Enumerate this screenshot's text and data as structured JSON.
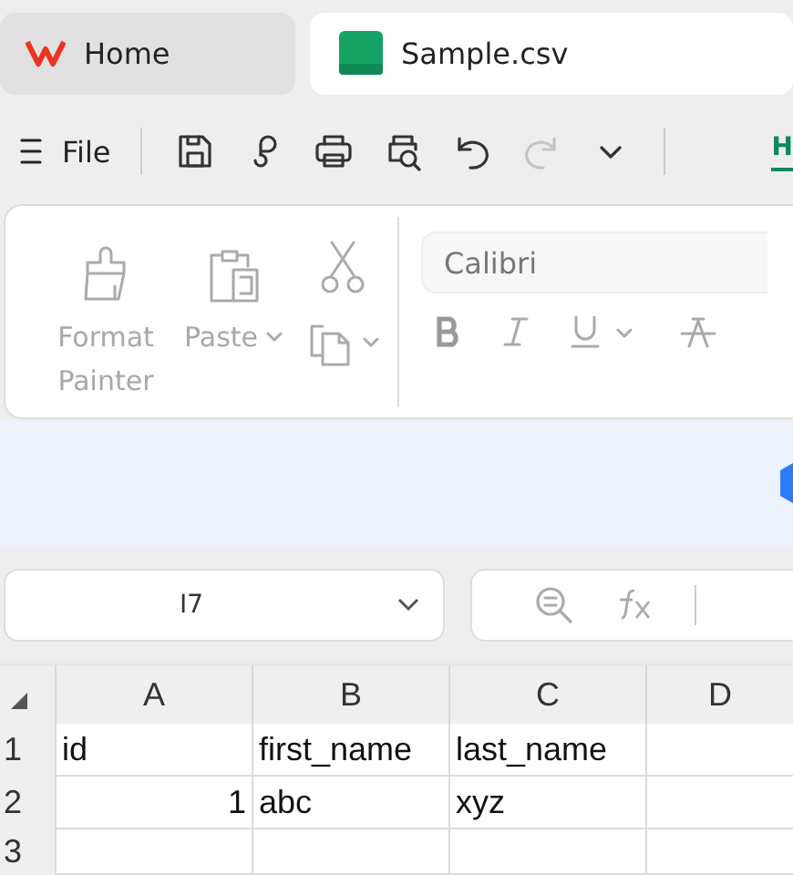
{
  "tabs": [
    {
      "label": "Home",
      "kind": "home",
      "selected": false
    },
    {
      "label": "Sample.csv",
      "kind": "sheet",
      "selected": true
    }
  ],
  "toolbar": {
    "menu_label": "File",
    "icons": [
      {
        "kind": "save",
        "disabled": false
      },
      {
        "kind": "share",
        "disabled": false
      },
      {
        "kind": "print",
        "disabled": false
      },
      {
        "kind": "preview",
        "disabled": false
      },
      {
        "kind": "undo",
        "disabled": false
      },
      {
        "kind": "redo",
        "disabled": true
      },
      {
        "kind": "more",
        "disabled": false
      }
    ],
    "ribbon_tab": "H"
  },
  "ribbon": {
    "format_painter": "Format Painter",
    "paste": "Paste",
    "font": "Calibri"
  },
  "name_box": "I7",
  "grid": {
    "columns": [
      "A",
      "B",
      "C",
      "D"
    ],
    "rows": [
      {
        "header": "1",
        "cells": [
          {
            "text": "id",
            "kind": "text"
          },
          {
            "text": "first_name",
            "kind": "text"
          },
          {
            "text": "last_name",
            "kind": "text"
          }
        ]
      },
      {
        "header": "2",
        "cells": [
          {
            "text": "1",
            "kind": "number"
          },
          {
            "text": "abc",
            "kind": "text"
          },
          {
            "text": "xyz",
            "kind": "text"
          }
        ]
      },
      {
        "header": "3",
        "cells": []
      }
    ]
  }
}
